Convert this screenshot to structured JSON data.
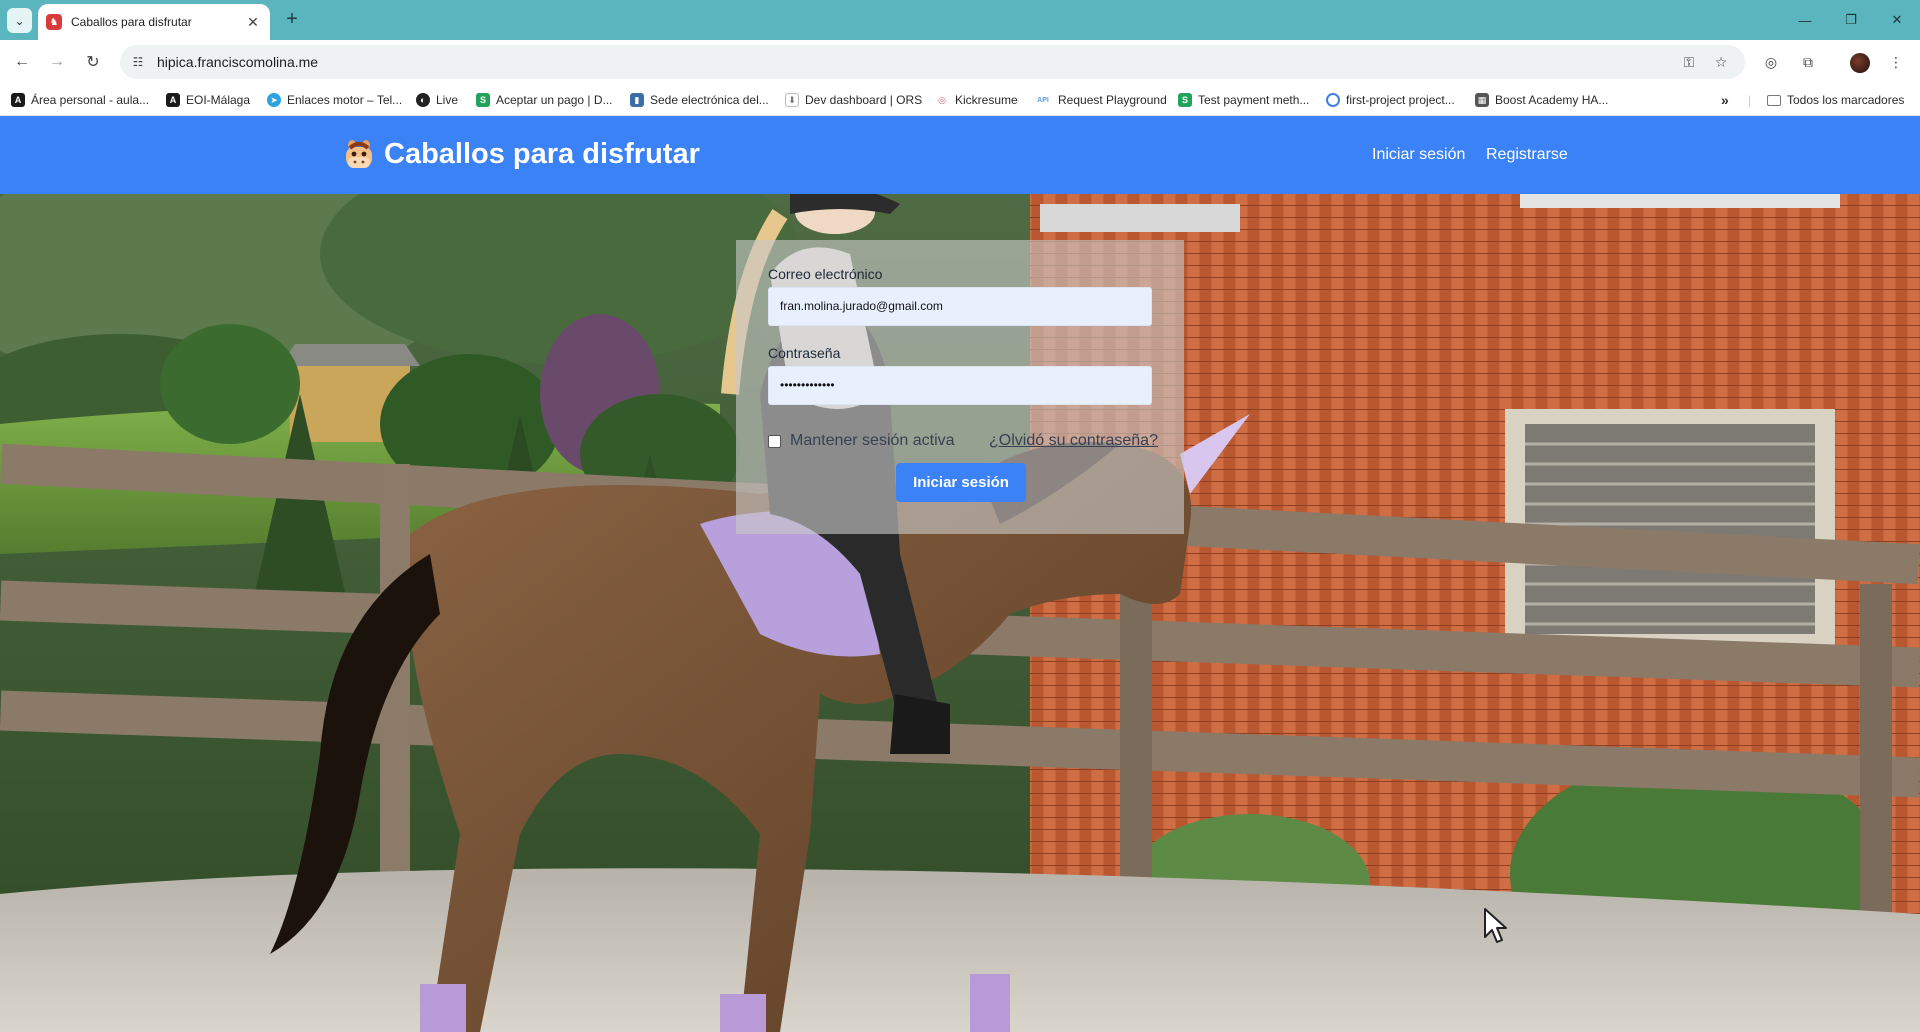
{
  "browser": {
    "tab": {
      "title": "Caballos para disfrutar"
    },
    "url": "hipica.franciscomolina.me",
    "bookmarks": [
      {
        "label": "Área personal - aula...",
        "icon": "aula-icon",
        "color": "#1a1a1a",
        "glyph": "A"
      },
      {
        "label": "EOI-Málaga",
        "icon": "eoi-icon",
        "color": "#1a1a1a",
        "glyph": "A"
      },
      {
        "label": "Enlaces motor – Tel...",
        "icon": "telegram-icon",
        "color": "#2aa3e0",
        "glyph": "➤"
      },
      {
        "label": "Live",
        "icon": "live-icon",
        "color": "#222222",
        "glyph": "◐"
      },
      {
        "label": "Aceptar un pago | D...",
        "icon": "stripe-icon",
        "color": "#21a35b",
        "glyph": "S"
      },
      {
        "label": "Sede electrónica del...",
        "icon": "sede-icon",
        "color": "#3a6ea5",
        "glyph": "▮"
      },
      {
        "label": "Dev dashboard | ORS",
        "icon": "ors-icon",
        "color": "#888888",
        "glyph": "⬇"
      },
      {
        "label": "Kickresume",
        "icon": "kickresume-icon",
        "color": "#e35d6a",
        "glyph": "◎"
      },
      {
        "label": "Request Playground",
        "icon": "api-icon",
        "color": "#5aa0e6",
        "glyph": "API"
      },
      {
        "label": "Test payment meth...",
        "icon": "stripe-icon",
        "color": "#21a35b",
        "glyph": "S"
      },
      {
        "label": "first-project project...",
        "icon": "firebase-icon",
        "color": "#3f7fe0",
        "glyph": "◌"
      },
      {
        "label": "Boost Academy HA...",
        "icon": "boost-icon",
        "color": "#555555",
        "glyph": "▦"
      }
    ],
    "all_bookmarks_label": "Todos los marcadores"
  },
  "site": {
    "brand": "Caballos para disfrutar",
    "nav": {
      "login": "Iniciar sesión",
      "register": "Registrarse"
    },
    "accent": "#3b82f6"
  },
  "login_form": {
    "email_label": "Correo electrónico",
    "email_value": "fran.molina.jurado@gmail.com",
    "password_label": "Contraseña",
    "password_value": "•••••••••••••",
    "remember_label": "Mantener sesión activa",
    "remember_checked": false,
    "forgot_label": "¿Olvidó su contraseña?",
    "submit_label": "Iniciar sesión"
  }
}
